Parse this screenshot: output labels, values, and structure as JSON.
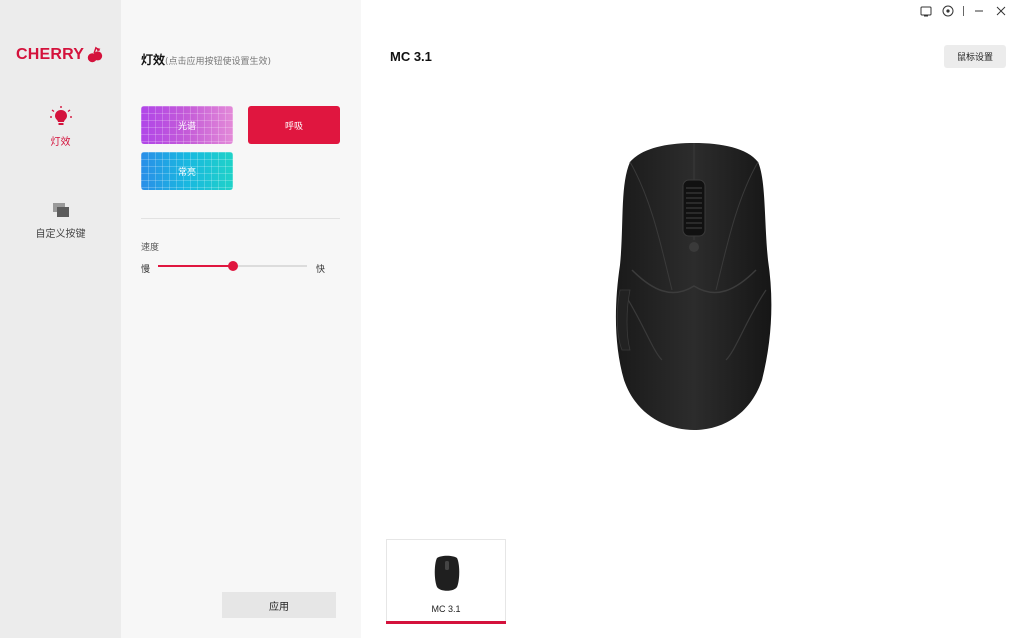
{
  "app": {
    "logo_text": "CHERRY",
    "accent_color": "#d4123c"
  },
  "nav": {
    "items": [
      {
        "label": "灯效",
        "icon": "bulb-icon",
        "active": true
      },
      {
        "label": "自定义按键",
        "icon": "keys-icon",
        "active": false
      }
    ]
  },
  "panel": {
    "title": "灯效",
    "hint": "(点击应用按钮使设置生效)",
    "effects": [
      {
        "label": "光谱",
        "selected": false
      },
      {
        "label": "呼吸",
        "selected": true
      },
      {
        "label": "常亮",
        "selected": false
      }
    ],
    "speed": {
      "label": "速度",
      "slow": "慢",
      "fast": "快",
      "value": 0.5
    },
    "apply_label": "应用"
  },
  "main": {
    "device_title": "MC 3.1",
    "mouse_settings_label": "鼠标设置",
    "window_controls": [
      "window-mode-icon",
      "settings-circle-icon",
      "minimize-icon",
      "close-icon"
    ],
    "devices": [
      {
        "name": "MC 3.1",
        "selected": true
      }
    ]
  }
}
